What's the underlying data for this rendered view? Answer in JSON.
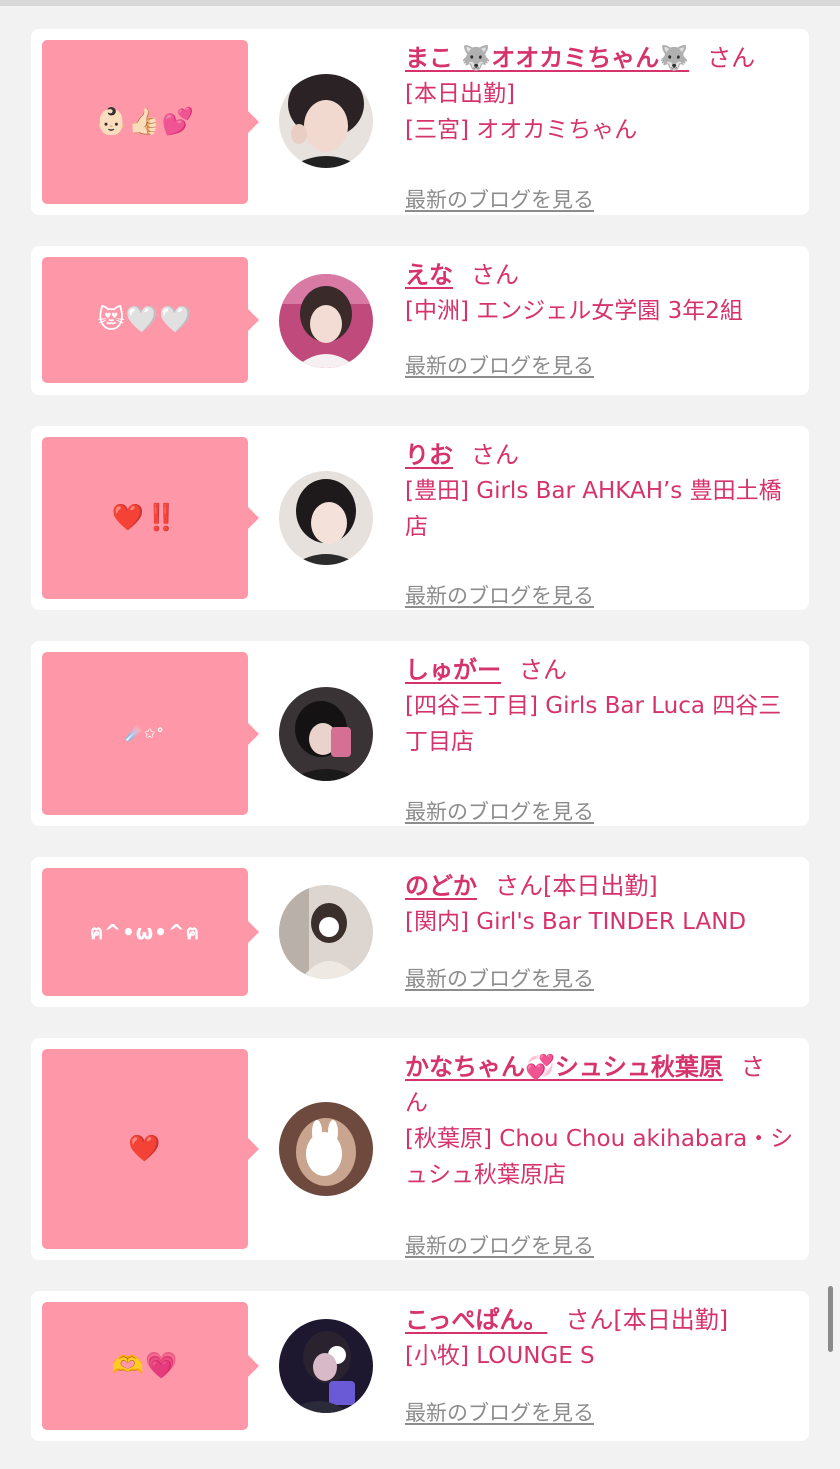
{
  "cards": [
    {
      "message": "👶🏻👍🏻💕",
      "name": "まこ 🐺オオカミちゃん🐺",
      "san": "さん",
      "lines": [
        "[本日出勤]",
        "[三宮] オオカミちゃん"
      ],
      "blog_link": "最新のブログを見る"
    },
    {
      "message": "😻🤍🤍",
      "name": "えな",
      "san": "さん",
      "lines": [
        "[中洲] エンジェル女学園 3年2組"
      ],
      "blog_link": "最新のブログを見る"
    },
    {
      "message": "❤️‼️",
      "name": "りお",
      "san": "さん",
      "lines": [
        "[豊田] Girls Bar AHKAH’s 豊田土橋",
        "店"
      ],
      "blog_link": "最新のブログを見る"
    },
    {
      "message": "☄️✩°",
      "name": "しゅがー",
      "san": "さん",
      "lines": [
        "[四谷三丁目] Girls Bar Luca 四谷三",
        "丁目店"
      ],
      "blog_link": "最新のブログを見る"
    },
    {
      "message": "ฅ^•ω•^ฅ",
      "name": "のどか",
      "san": "さん[本日出勤]",
      "lines": [
        "[関内] Girl's Bar TINDER LAND"
      ],
      "blog_link": "最新のブログを見る"
    },
    {
      "message": "❤️",
      "name": "かなちゃん💞シュシュ秋葉原",
      "san": "さ",
      "san_wrap": "ん",
      "lines": [
        "[秋葉原] Chou Chou akihabara・シ",
        "ュシュ秋葉原店"
      ],
      "blog_link": "最新のブログを見る"
    },
    {
      "message": "🫶💗",
      "name": "こっぺぱん。",
      "san": "さん[本日出勤]",
      "lines": [
        "[小牧] LOUNGE S"
      ],
      "blog_link": "最新のブログを見る"
    }
  ],
  "colors": {
    "accent": "#d6336c",
    "bubble": "#fe98a9",
    "link_gray": "#8c8c8c"
  }
}
